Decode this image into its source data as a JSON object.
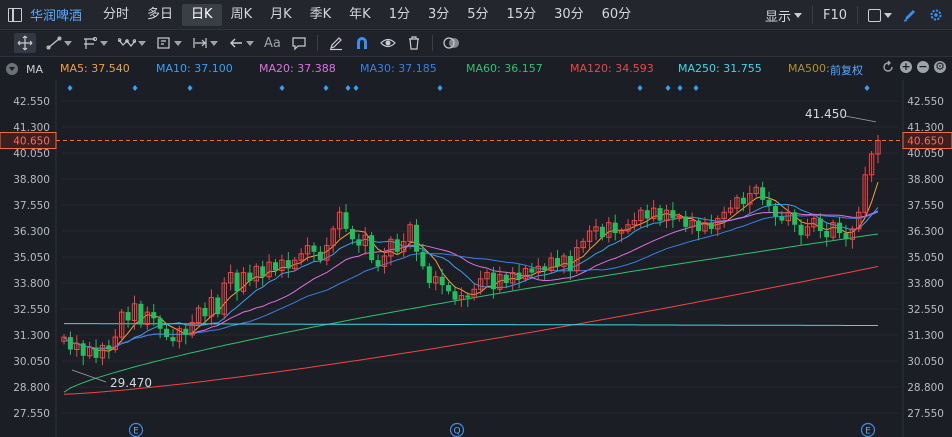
{
  "header": {
    "stock_name": "华润啤酒",
    "periods": [
      "分时",
      "多日",
      "日K",
      "周K",
      "月K",
      "季K",
      "年K",
      "1分",
      "3分",
      "5分",
      "15分",
      "30分",
      "60分"
    ],
    "active_period": "日K",
    "display_label": "显示",
    "f10_label": "F10"
  },
  "toolbar": {
    "text_tool_label": "Aa"
  },
  "ma_legend": {
    "label": "MA",
    "items": [
      {
        "name": "MA5",
        "value": "37.540",
        "text": "MA5: 37.540",
        "color": "#f0a040"
      },
      {
        "name": "MA10",
        "value": "37.100",
        "text": "MA10: 37.100",
        "color": "#3aa0f0"
      },
      {
        "name": "MA20",
        "value": "37.388",
        "text": "MA20: 37.388",
        "color": "#e070e0"
      },
      {
        "name": "MA30",
        "value": "37.185",
        "text": "MA30: 37.185",
        "color": "#3a80e0"
      },
      {
        "name": "MA60",
        "value": "36.157",
        "text": "MA60: 36.157",
        "color": "#30c070"
      },
      {
        "name": "MA120",
        "value": "34.593",
        "text": "MA120: 34.593",
        "color": "#f04545"
      },
      {
        "name": "MA250",
        "value": "31.755",
        "text": "MA250: 31.755",
        "color": "#40d8e8"
      },
      {
        "name": "MA500",
        "value": "",
        "text": "MA500:",
        "color": "#b09030"
      }
    ],
    "adjust_label": "前复权"
  },
  "colors": {
    "up": "#f04545",
    "down": "#20c060",
    "background": "#1b1e24",
    "price_line": "#f07040"
  },
  "chart_data": {
    "type": "candlestick",
    "y_ticks": [
      "42.550",
      "41.300",
      "40.050",
      "38.800",
      "37.550",
      "36.300",
      "35.050",
      "33.800",
      "32.550",
      "31.300",
      "30.050",
      "28.800",
      "27.550"
    ],
    "ylim": [
      27.55,
      42.55
    ],
    "current_price": "40.650",
    "high_label": "41.450",
    "low_label": "29.470",
    "event_markers": [
      "E",
      "Q",
      "E"
    ],
    "closes": [
      31.2,
      30.6,
      30.9,
      30.3,
      30.7,
      30.2,
      30.8,
      30.6,
      31.2,
      32.4,
      32.0,
      32.8,
      31.8,
      32.4,
      32.1,
      31.6,
      31.2,
      31.0,
      31.6,
      31.3,
      31.9,
      32.6,
      32.2,
      33.1,
      32.3,
      33.8,
      34.3,
      33.4,
      34.3,
      33.9,
      34.6,
      34.1,
      34.8,
      34.4,
      34.9,
      34.5,
      34.9,
      35.2,
      35.6,
      35.3,
      34.9,
      35.6,
      36.4,
      37.2,
      36.4,
      35.9,
      35.6,
      36.1,
      34.9,
      34.6,
      35.1,
      35.9,
      35.3,
      35.8,
      36.6,
      35.3,
      34.6,
      33.8,
      34.1,
      33.7,
      33.4,
      33.0,
      33.2,
      33.1,
      33.5,
      34.0,
      34.3,
      33.5,
      34.2,
      33.8,
      34.3,
      34.0,
      34.5,
      34.3,
      34.6,
      34.4,
      35.0,
      34.6,
      35.1,
      34.4,
      35.5,
      35.8,
      36.3,
      36.5,
      36.0,
      36.7,
      36.2,
      36.3,
      36.6,
      36.8,
      37.3,
      36.9,
      37.4,
      36.8,
      37.3,
      36.9,
      37.0,
      36.5,
      36.8,
      36.3,
      36.7,
      36.4,
      36.9,
      37.2,
      37.4,
      37.9,
      37.6,
      38.1,
      38.4,
      37.8,
      37.5,
      37.0,
      36.8,
      37.2,
      36.6,
      36.1,
      36.5,
      36.9,
      36.3,
      36.0,
      36.7,
      36.2,
      35.9,
      36.4,
      37.2,
      39.0,
      40.0,
      40.65
    ]
  }
}
